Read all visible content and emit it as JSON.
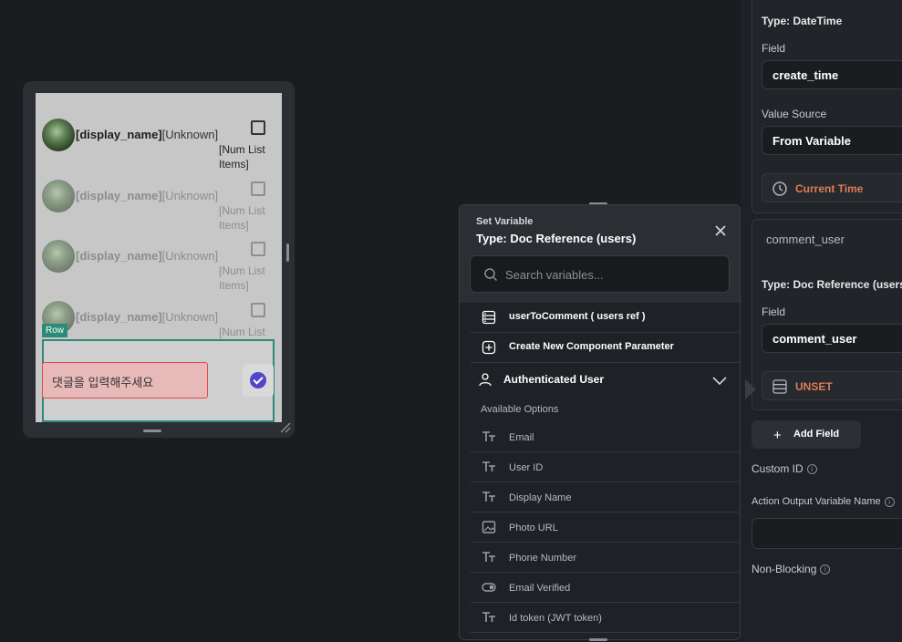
{
  "canvas": {
    "list_items": [
      {
        "name": "[display_name]",
        "status": "[Unknown]",
        "num": "[Num List Items]"
      },
      {
        "name": "[display_name]",
        "status": "[Unknown]",
        "num": "[Num List Items]"
      },
      {
        "name": "[display_name]",
        "status": "[Unknown]",
        "num": "[Num List Items]"
      },
      {
        "name": "[display_name]",
        "status": "[Unknown]",
        "num": "[Num List"
      }
    ],
    "row_tag": "Row",
    "comment_placeholder": "댓글을 입력해주세요"
  },
  "popup": {
    "subtitle": "Set Variable",
    "title": "Type: Doc Reference (users)",
    "search_placeholder": "Search variables...",
    "options": [
      {
        "label": "userToComment ( users ref )",
        "icon": "database-icon"
      },
      {
        "label": "Create New Component Parameter",
        "icon": "plus-square-icon"
      }
    ],
    "auth_section": "Authenticated User",
    "available_label": "Available Options",
    "fields": [
      {
        "label": "Email",
        "icon": "text-type-icon"
      },
      {
        "label": "User ID",
        "icon": "text-type-icon"
      },
      {
        "label": "Display Name",
        "icon": "text-type-icon"
      },
      {
        "label": "Photo URL",
        "icon": "image-icon"
      },
      {
        "label": "Phone Number",
        "icon": "text-type-icon"
      },
      {
        "label": "Email Verified",
        "icon": "toggle-icon"
      },
      {
        "label": "Id token (JWT token)",
        "icon": "text-type-icon"
      }
    ]
  },
  "panel": {
    "type_datetime": "Type: DateTime",
    "field_label_1": "Field",
    "field_value_1": "create_time",
    "value_source_label": "Value Source",
    "value_source_value": "From Variable",
    "current_time": "Current Time",
    "comment_user_header": "comment_user",
    "type_docref": "Type: Doc Reference (users",
    "field_label_2": "Field",
    "field_value_2": "comment_user",
    "unset": "UNSET",
    "add_field": "Add Field",
    "custom_id": "Custom ID",
    "action_output": "Action Output Variable Name",
    "non_blocking": "Non-Blocking"
  },
  "colors": {
    "accent_orange": "#e07b52",
    "selection_teal": "#2c8a78",
    "check_purple": "#5145c8",
    "error_red": "#e44b4b"
  }
}
